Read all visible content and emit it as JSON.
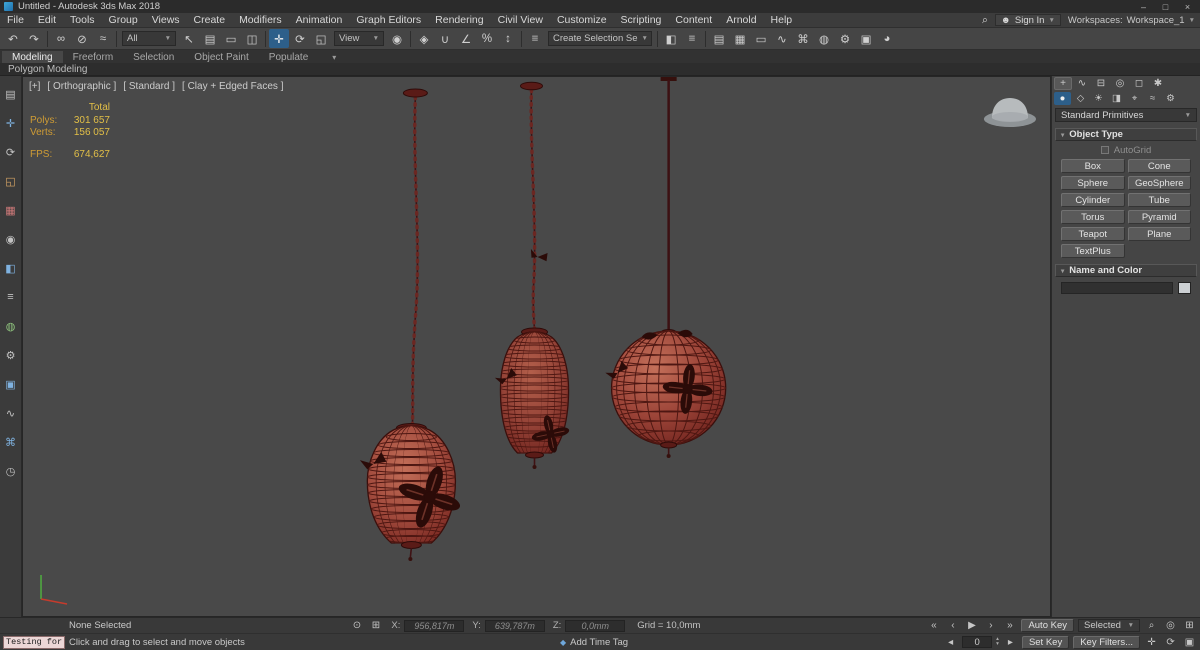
{
  "window": {
    "title": "Untitled - Autodesk 3ds Max 2018"
  },
  "menubar": {
    "items": [
      "File",
      "Edit",
      "Tools",
      "Group",
      "Views",
      "Create",
      "Modifiers",
      "Animation",
      "Graph Editors",
      "Rendering",
      "Civil View",
      "Customize",
      "Scripting",
      "Content",
      "Arnold",
      "Help"
    ],
    "sign_in": "Sign In",
    "workspaces_label": "Workspaces:",
    "workspace_value": "Workspace_1"
  },
  "toolbar": {
    "filter": "All",
    "ref_coord": "View",
    "named_selection": "Create Selection Se"
  },
  "ribbon": {
    "tabs": [
      "Modeling",
      "Freeform",
      "Selection",
      "Object Paint",
      "Populate"
    ],
    "subtab": "Polygon Modeling"
  },
  "viewport": {
    "label_plus": "[+]",
    "label_pov": "[ Orthographic ]",
    "label_standard": "[ Standard ]",
    "label_shading": "[ Clay + Edged Faces ]",
    "stats": {
      "total": "Total",
      "polys_label": "Polys:",
      "polys": "301 657",
      "verts_label": "Verts:",
      "verts": "156 057",
      "fps_label": "FPS:",
      "fps": "674,627"
    }
  },
  "command_panel": {
    "category": "Standard Primitives",
    "object_type": "Object Type",
    "autogrid": "AutoGrid",
    "name_and_color": "Name and Color",
    "buttons": [
      "Box",
      "Cone",
      "Sphere",
      "GeoSphere",
      "Cylinder",
      "Tube",
      "Torus",
      "Pyramid",
      "Teapot",
      "Plane",
      "TextPlus"
    ]
  },
  "statusbar": {
    "none_selected": "None Selected",
    "prompt": "Click and drag to select and move objects",
    "listener": "Testing for i",
    "x_label": "X:",
    "x_value": "956,817m",
    "y_label": "Y:",
    "y_value": "639,787m",
    "z_label": "Z:",
    "z_value": "0,0mm",
    "grid": "Grid = 10,0mm",
    "add_time_tag": "Add Time Tag",
    "auto_key": "Auto Key",
    "set_key": "Set Key",
    "key_mode": "Selected",
    "key_filters": "Key Filters...",
    "frame": "0"
  },
  "side_icons": [
    "▤",
    "✛",
    "⟳",
    "◱",
    "▦",
    "◉",
    "◧",
    "≡",
    "◍",
    "⚙",
    "▣",
    "∿",
    "⌘",
    "◷"
  ],
  "icons": {
    "minimize": "–",
    "maximize": "□",
    "close": "×",
    "search": "⌕",
    "user": "☻",
    "caret": "▼",
    "collapse": "▾",
    "undo": "↶",
    "redo": "↷",
    "link": "∞",
    "unlink": "⊘",
    "bind": "≈",
    "select": "↖",
    "select_by_name": "▤",
    "region": "▭",
    "window_crossing": "◫",
    "move": "✛",
    "rotate": "⟳",
    "scale": "◱",
    "ref_pivot": "◉",
    "manipulate": "◈",
    "snap": "∪",
    "angle_snap": "∠",
    "percent_snap": "%",
    "spinner_snap": "↕",
    "named_sets": "≡",
    "mirror": "◧",
    "align": "≡",
    "scene_explorer": "▤",
    "layer_explorer": "▦",
    "ribbon_toggle": "▭",
    "curve_editor": "∿",
    "schematic": "⌘",
    "material_editor": "◍",
    "render_setup": "⚙",
    "rendered_frame": "▣",
    "render": "◕",
    "create": "+",
    "modify": "∿",
    "hierarchy": "⊟",
    "motion": "◎",
    "display": "◻",
    "utilities": "✱",
    "geometry": "●",
    "shapes": "◇",
    "lights": "☀",
    "cameras": "◨",
    "helpers": "⌖",
    "space_warps": "≈",
    "systems": "⚙",
    "lock": "⊙",
    "absolute": "⊞",
    "t_start": "«",
    "t_prev": "‹",
    "t_play": "▶",
    "t_next": "›",
    "t_end": "»",
    "prev_key": "◂",
    "next_key": "▸",
    "spin_up": "▴",
    "spin_dn": "▾",
    "tag": "◆",
    "zoom": "⌕",
    "zoom_all": "◎",
    "zoom_extents": "⊞",
    "pan": "✛",
    "orbit": "⟳",
    "max_viewport": "▣"
  }
}
